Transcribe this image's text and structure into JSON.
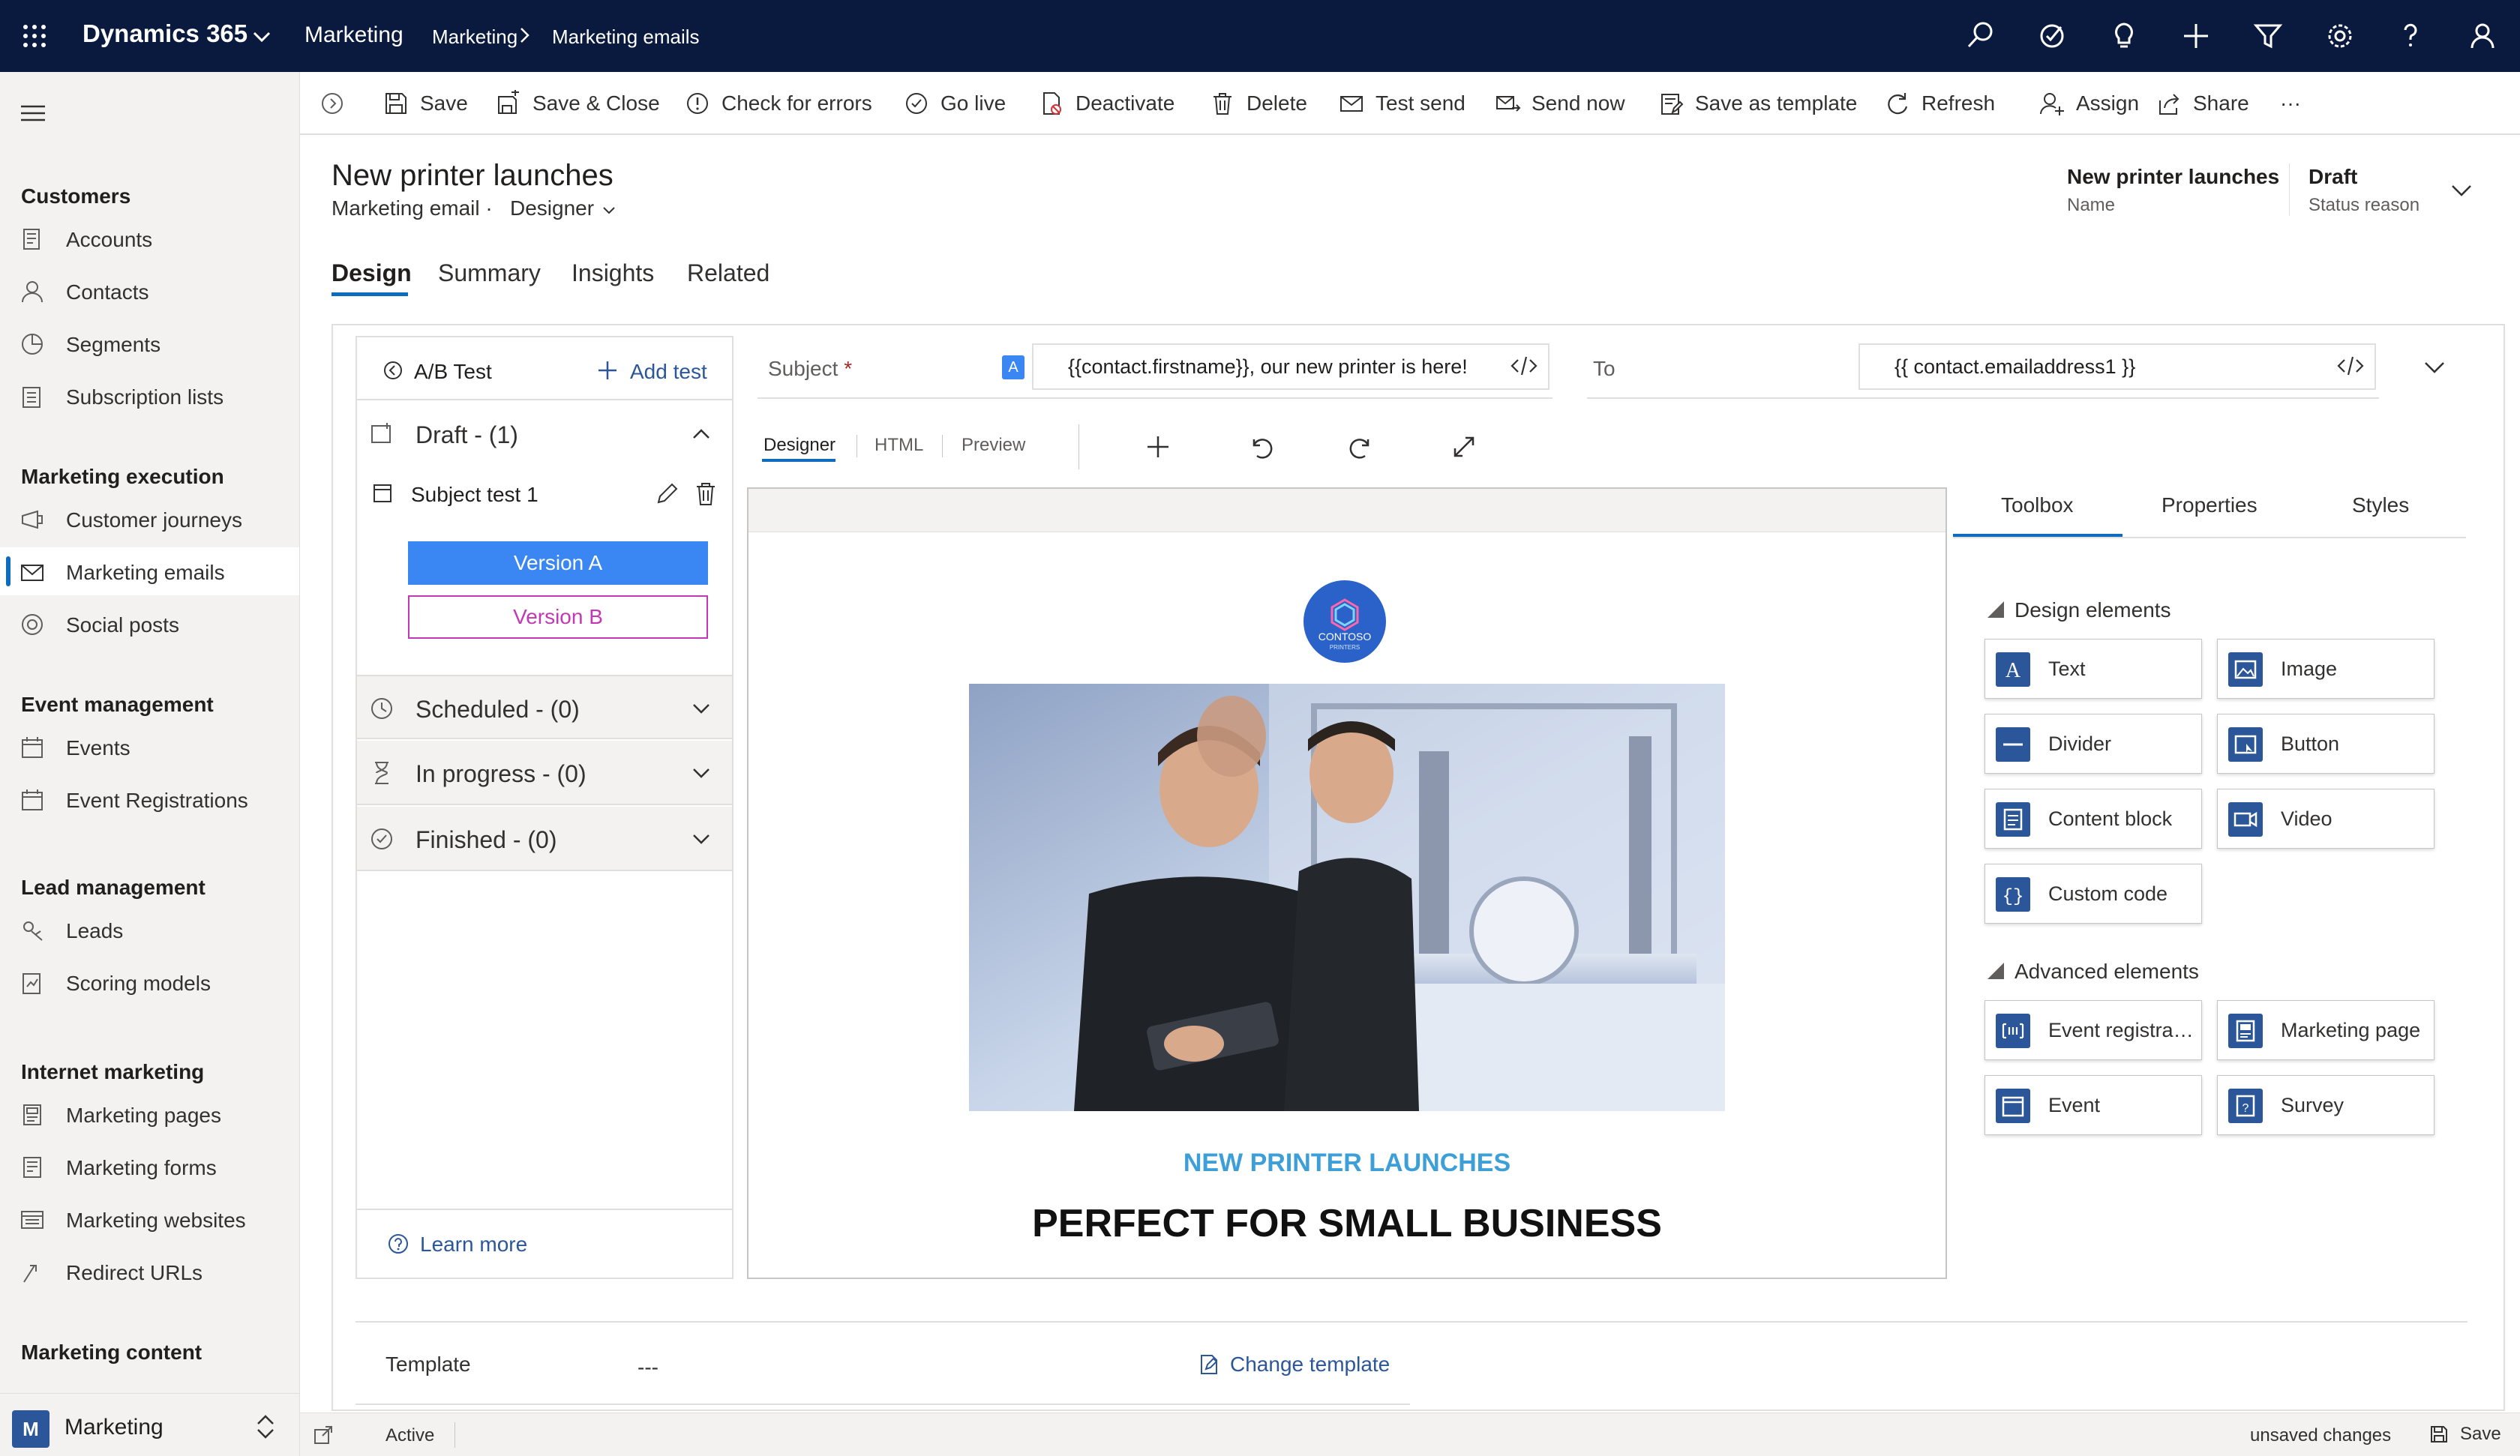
{
  "topbar": {
    "brand": "Dynamics 365",
    "app": "Marketing",
    "breadcrumb": [
      "Marketing",
      "Marketing emails"
    ],
    "icons": [
      "search-icon",
      "task-icon",
      "lightbulb-icon",
      "plus-icon",
      "filter-icon",
      "settings-icon",
      "help-icon",
      "user-icon"
    ]
  },
  "nav": {
    "groups": [
      {
        "title": "Customers",
        "items": [
          {
            "label": "Accounts",
            "icon": "accounts-icon"
          },
          {
            "label": "Contacts",
            "icon": "contact-icon"
          },
          {
            "label": "Segments",
            "icon": "segments-icon"
          },
          {
            "label": "Subscription lists",
            "icon": "list-icon"
          }
        ]
      },
      {
        "title": "Marketing execution",
        "items": [
          {
            "label": "Customer journeys",
            "icon": "journey-icon"
          },
          {
            "label": "Marketing emails",
            "icon": "mail-icon"
          },
          {
            "label": "Social posts",
            "icon": "social-icon"
          }
        ]
      },
      {
        "title": "Event management",
        "items": [
          {
            "label": "Events",
            "icon": "calendar-icon"
          },
          {
            "label": "Event Registrations",
            "icon": "calendar-icon"
          }
        ]
      },
      {
        "title": "Lead management",
        "items": [
          {
            "label": "Leads",
            "icon": "leads-icon"
          },
          {
            "label": "Scoring models",
            "icon": "scoring-icon"
          }
        ]
      },
      {
        "title": "Internet marketing",
        "items": [
          {
            "label": "Marketing pages",
            "icon": "page-icon"
          },
          {
            "label": "Marketing forms",
            "icon": "form-icon"
          },
          {
            "label": "Marketing websites",
            "icon": "website-icon"
          },
          {
            "label": "Redirect URLs",
            "icon": "redirect-icon"
          }
        ]
      },
      {
        "title": "Marketing content",
        "items": []
      }
    ],
    "selected": "Marketing emails",
    "area_badge": "M",
    "area_label": "Marketing"
  },
  "commands": [
    "Save",
    "Save & Close",
    "Check for errors",
    "Go live",
    "Deactivate",
    "Delete",
    "Test send",
    "Send now",
    "Save as template",
    "Refresh",
    "Assign",
    "Share",
    "···"
  ],
  "record": {
    "title": "New printer launches",
    "entity": "Marketing email",
    "separator": "·",
    "form": "Designer",
    "name_value": "New printer launches",
    "name_label": "Name",
    "status_value": "Draft",
    "status_label": "Status reason"
  },
  "tabs": [
    "Design",
    "Summary",
    "Insights",
    "Related"
  ],
  "ab": {
    "title": "A/B Test",
    "add": "Add test",
    "draft": "Draft - (1)",
    "test_name": "Subject test 1",
    "version_a": "Version A",
    "version_b": "Version B",
    "scheduled": "Scheduled - (0)",
    "in_progress": "In progress - (0)",
    "finished": "Finished - (0)",
    "learn_more": "Learn more"
  },
  "subject": {
    "label": "Subject",
    "required": "*",
    "badge": "A",
    "value": "{{contact.firstname}}, our new printer is here!"
  },
  "to": {
    "label": "To",
    "value": "{{ contact.emailaddress1 }}"
  },
  "designer_tabs": [
    "Designer",
    "HTML",
    "Preview"
  ],
  "canvas": {
    "logo_text": "CONTOSO",
    "logo_sub": "PRINTERS",
    "kicker": "NEW PRINTER LAUNCHES",
    "headline": "PERFECT FOR SMALL BUSINESS"
  },
  "toolbox": {
    "tabs": [
      "Toolbox",
      "Properties",
      "Styles"
    ],
    "design_title": "Design elements",
    "design": [
      "Text",
      "Image",
      "Divider",
      "Button",
      "Content block",
      "Video",
      "Custom code"
    ],
    "advanced_title": "Advanced elements",
    "advanced": [
      "Event registration",
      "Marketing page",
      "Event",
      "Survey"
    ]
  },
  "template": {
    "label": "Template",
    "value": "---",
    "change": "Change template"
  },
  "footer": {
    "status": "Active",
    "unsaved": "unsaved changes",
    "save": "Save"
  },
  "colors": {
    "topbar": "#0a1a3e",
    "accent": "#0f6cbd",
    "version_a": "#3a86f2",
    "version_b": "#c239b3",
    "kicker": "#3d9fd8",
    "link": "#2b579a"
  }
}
